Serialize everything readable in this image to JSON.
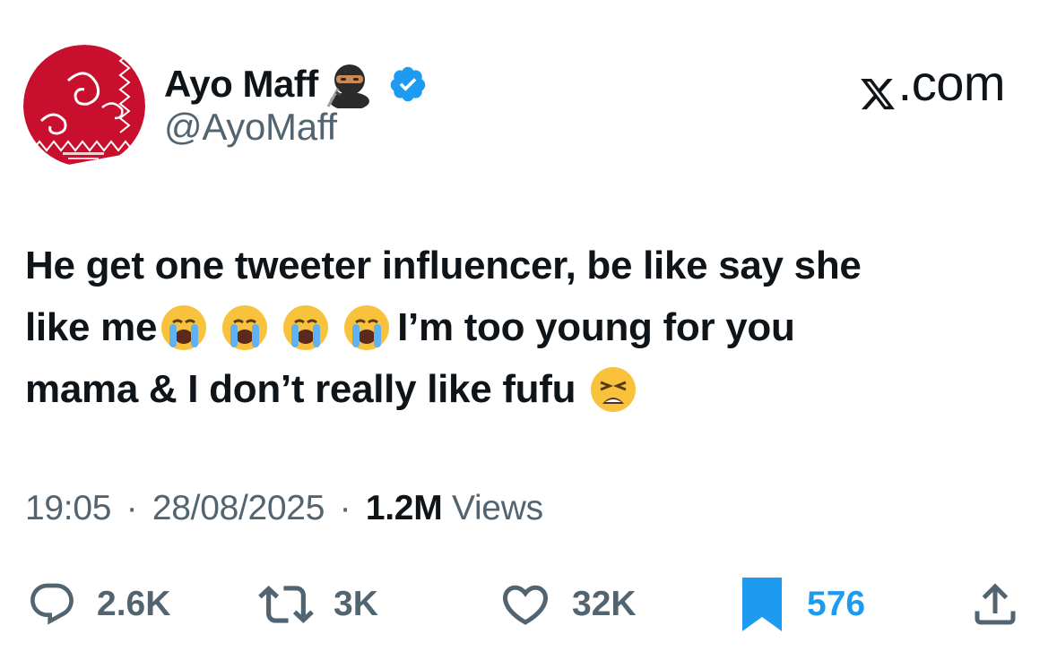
{
  "author": {
    "display_name": "Ayo Maff",
    "handle": "@AyoMaff",
    "avatar_alt": "red paisley bandana avatar",
    "name_emoji": "ninja-emoji",
    "verified": true
  },
  "site": {
    "label": ".com",
    "logo": "x-logo-icon"
  },
  "tweet": {
    "line1": "He get one tweeter influencer, be like say she",
    "line2_start": "like me",
    "line2_end": "I’m too young for you",
    "line3": "mama & I don’t really like fufu",
    "emojis": [
      "loudly-crying-face",
      "loudly-crying-face",
      "loudly-crying-face",
      "loudly-crying-face",
      "weary-face"
    ]
  },
  "meta": {
    "time": "19:05",
    "sep1": "·",
    "date": "28/08/2025",
    "sep2": "·",
    "views_count": "1.2M",
    "views_label": "Views"
  },
  "actions": {
    "replies": "2.6K",
    "reposts": "3K",
    "likes": "32K",
    "bookmarks": "576"
  },
  "colors": {
    "text": "#0f1419",
    "secondary": "#536471",
    "accent": "#1d9bf0",
    "avatar_red": "#c8102e"
  }
}
